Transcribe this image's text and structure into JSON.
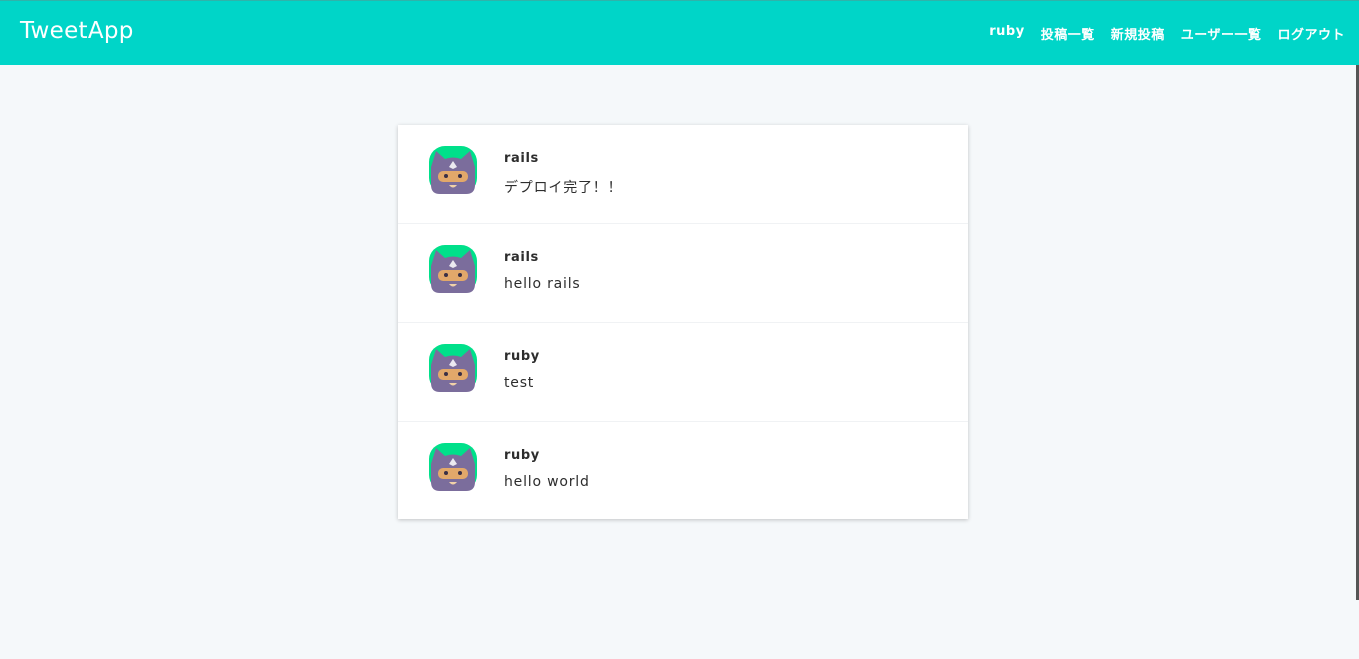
{
  "header": {
    "logo": "TweetApp",
    "nav": [
      "ruby",
      "投稿一覧",
      "新規投稿",
      "ユーザー一覧",
      "ログアウト"
    ]
  },
  "posts": [
    {
      "user": "rails",
      "content": "デプロイ完了！！",
      "avatar_icon": "cat-ninja-avatar-icon"
    },
    {
      "user": "rails",
      "content": "hello rails",
      "avatar_icon": "cat-ninja-avatar-icon"
    },
    {
      "user": "ruby",
      "content": "test",
      "avatar_icon": "cat-ninja-avatar-icon"
    },
    {
      "user": "ruby",
      "content": "hello world",
      "avatar_icon": "cat-ninja-avatar-icon"
    }
  ],
  "colors": {
    "header_bg": "#00d5c8",
    "page_bg": "#f5f8fa",
    "card_bg": "#ffffff",
    "avatar_green": "#00e08a",
    "avatar_purple": "#7b6d9c"
  }
}
